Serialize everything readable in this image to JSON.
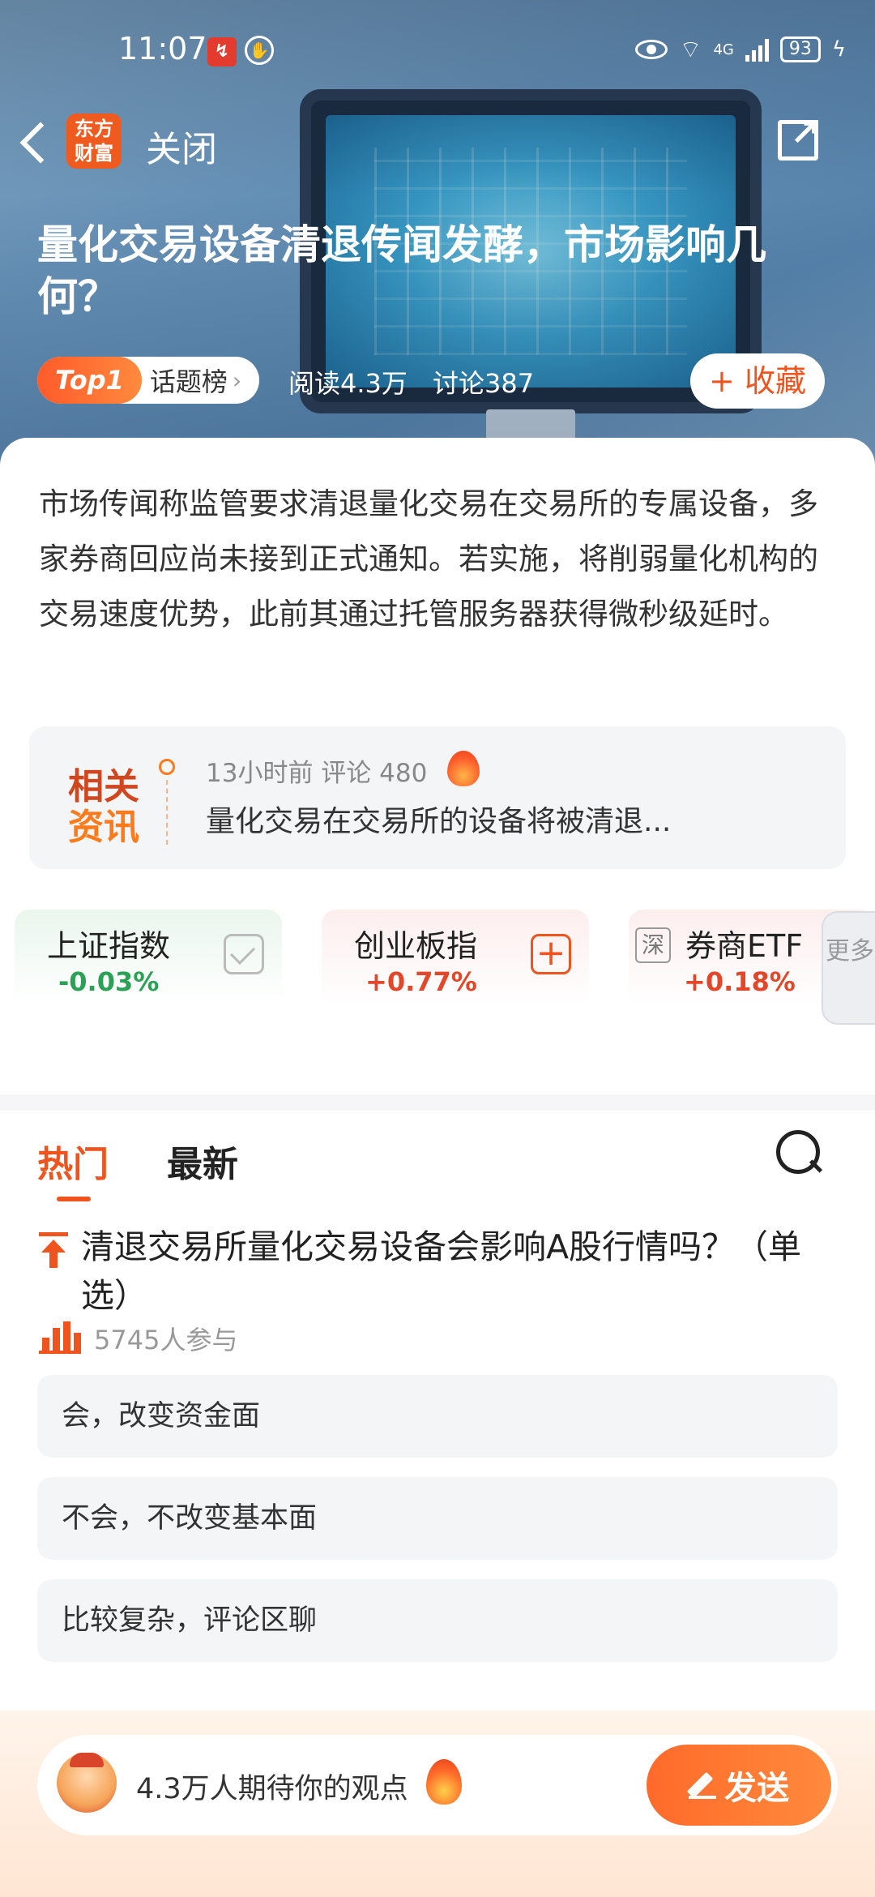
{
  "status_bar": {
    "time": "11:07",
    "network": "4G",
    "battery": "93"
  },
  "nav": {
    "logo_text": "东方财富",
    "close_label": "关闭"
  },
  "article": {
    "title": "量化交易设备清退传闻发酵，市场影响几何？",
    "topic_rank": "Top1",
    "topic_label": "话题榜",
    "reads": "阅读4.3万",
    "discussions": "讨论387",
    "collect_label": "+ 收藏",
    "summary": "市场传闻称监管要求清退量化交易在交易所的专属设备，多家券商回应尚未接到正式通知。若实施，将削弱量化机构的交易速度优势，此前其通过托管服务器获得微秒级延时。"
  },
  "related": {
    "tag_line1": "相关",
    "tag_line2": "资讯",
    "meta": "13小时前  评论 480",
    "headline": "量化交易在交易所的设备将被清退..."
  },
  "indices": [
    {
      "name": "上证指数",
      "change": "-0.03%"
    },
    {
      "name": "创业板指",
      "change": "+0.77%"
    },
    {
      "name": "券商ETF",
      "change": "+0.18%",
      "exchange_tag": "深"
    }
  ],
  "more_label": "更多",
  "tabs": {
    "hot": "热门",
    "latest": "最新"
  },
  "poll": {
    "question": "清退交易所量化交易设备会影响A股行情吗？（单选）",
    "participants": "5745人参与",
    "options": [
      "会，改变资金面",
      "不会，不改变基本面",
      "比较复杂，评论区聊"
    ]
  },
  "comment_bar": {
    "prompt": "4.3万人期待你的观点",
    "send_label": "发送"
  },
  "colors": {
    "accent": "#f0541e",
    "down": "#2aa155",
    "up": "#e2472a"
  }
}
